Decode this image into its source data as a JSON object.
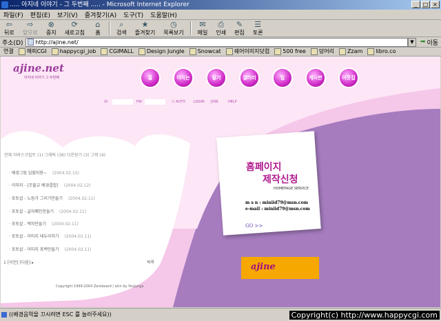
{
  "window": {
    "title": "..... 아지네 이야기 - 그 두번째 ..... - Microsoft Internet Explorer",
    "controls": [
      "_",
      "□",
      "×"
    ]
  },
  "menu": [
    "파일(F)",
    "편집(E)",
    "보기(V)",
    "즐겨찾기(A)",
    "도구(T)",
    "도움말(H)"
  ],
  "toolbar": [
    {
      "label": "뒤로",
      "icon": "back-arrow-icon",
      "glyph": "⇦",
      "disabled": false
    },
    {
      "label": "앞으로",
      "icon": "forward-arrow-icon",
      "glyph": "⇨",
      "disabled": true
    },
    {
      "label": "중지",
      "icon": "stop-icon",
      "glyph": "⊗",
      "disabled": false
    },
    {
      "label": "새로고침",
      "icon": "refresh-icon",
      "glyph": "⟳",
      "disabled": false
    },
    {
      "label": "홈",
      "icon": "home-icon",
      "glyph": "⌂",
      "disabled": false
    },
    {
      "label": "검색",
      "icon": "search-icon",
      "glyph": "⌕",
      "disabled": false
    },
    {
      "label": "즐겨찾기",
      "icon": "favorites-icon",
      "glyph": "★",
      "disabled": false
    },
    {
      "label": "목록보기",
      "icon": "history-icon",
      "glyph": "◷",
      "disabled": false
    },
    {
      "label": "메일",
      "icon": "mail-icon",
      "glyph": "✉",
      "disabled": false
    },
    {
      "label": "인쇄",
      "icon": "print-icon",
      "glyph": "⎙",
      "disabled": false
    },
    {
      "label": "편집",
      "icon": "edit-icon",
      "glyph": "✎",
      "disabled": false
    },
    {
      "label": "토론",
      "icon": "discuss-icon",
      "glyph": "☰",
      "disabled": false
    }
  ],
  "address": {
    "label": "주소(D)",
    "url": "http://ajine.net/",
    "go": "이동"
  },
  "links": {
    "label": "연결",
    "items": [
      "해피CGI",
      "happycgi_job",
      "CGIMALL",
      "Design Jungle",
      "Snowcat",
      "쉐어이미지닷컴",
      "500 free",
      "덩어리",
      "Zzam",
      "libro.co"
    ]
  },
  "site": {
    "logo": "ajine.net",
    "logo_sub": "아지네 이야기 그 두번째",
    "nav": [
      "홈",
      "아지는",
      "일기",
      "갤러리",
      "팁",
      "게시판",
      "이웃집"
    ],
    "login": {
      "id_label": "ID",
      "pw_label": "PW",
      "auto": "AUTO",
      "login": "LOGIN",
      "join": "JOIN",
      "help": "HELP"
    },
    "categories": "전체  자바스크립트 (1) 그래픽 (36) 다운받기 (3) 그외 (4)",
    "posts": [
      {
        "title": "배경그림 입혔지용~",
        "date": "(2004.02.15)"
      },
      {
        "title": "이미지 - [조물교 배경결합]",
        "date": "(2004.02.12)"
      },
      {
        "title": "포토샵 - 노듬가 그리기만들기",
        "date": "(2004.02.11)"
      },
      {
        "title": "포토샵 - 글자폐인한들기",
        "date": "(2004.02.11)"
      },
      {
        "title": "포토샵 - 액자만들기",
        "date": "(2004.02.11)"
      },
      {
        "title": "포토샵 - 이미지 테두리하기",
        "date": "(2004.02.11)"
      },
      {
        "title": "포토샵 - 이미지 흑백만들기",
        "date": "(2004.02.11)"
      }
    ],
    "pager": "1 [이전] [다음] ▸",
    "write": "목록",
    "footer": "Copyright 1999-2004 Zeroboard / skin by Yoojunge",
    "card": {
      "heading1": "홈페이지",
      "heading2": "제작신청",
      "subtitle": "HOMEPAGE SERVICE",
      "msn": "m s n :  miniid79@msn.com",
      "email": "e-mail :  miniid79@msn.com",
      "go": "GO >>"
    },
    "banner": "ajine"
  },
  "status": {
    "text": "((배경음악을 끄시려면 ESC 를 눌러주세요))",
    "copyright": "Copyright(c) http://www.happycgi.com"
  },
  "colors": {
    "bg_purple": "#a67cbf",
    "pink": "#f5c7e9",
    "accent": "#d02bc8",
    "banner": "#f6a800"
  }
}
